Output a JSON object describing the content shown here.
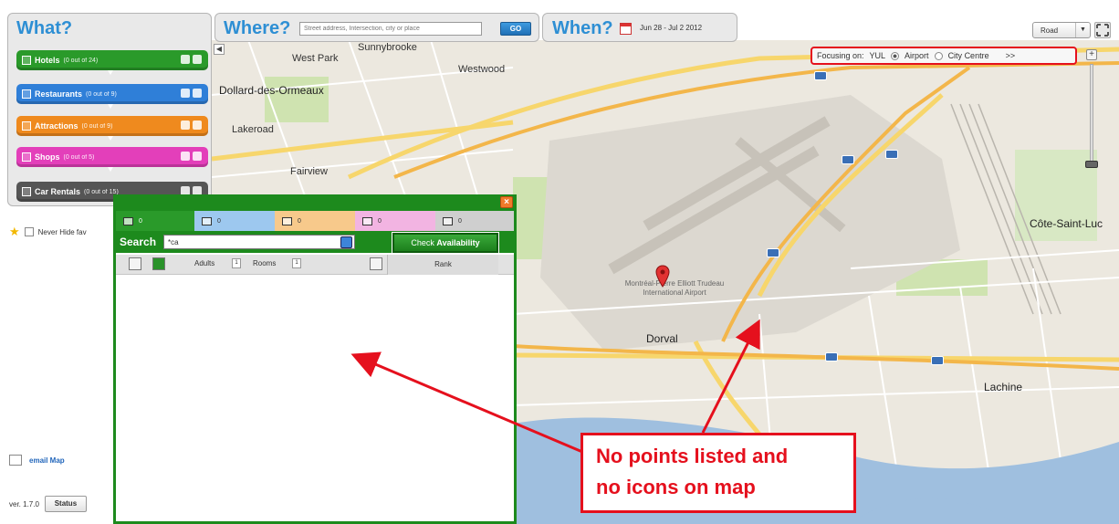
{
  "what": {
    "title": "What?",
    "categories": [
      {
        "label": "Hotels",
        "count": "(0 out of 24)",
        "color": "#2a9a2a"
      },
      {
        "label": "Restaurants",
        "count": "(0 out of 9)",
        "color": "#2f7fd8"
      },
      {
        "label": "Attractions",
        "count": "(0 out of 9)",
        "color": "#ef8a1e"
      },
      {
        "label": "Shops",
        "count": "(0 out of 5)",
        "color": "#e33fba"
      },
      {
        "label": "Car Rentals",
        "count": "(0 out of 15)",
        "color": "#555555"
      }
    ],
    "never_label": "Never Hide fav"
  },
  "where": {
    "title": "Where?",
    "placeholder": "Street address, Intersection, city or place",
    "go_label": "GO"
  },
  "when": {
    "title": "When?",
    "dates": "Jun 28 - Jul 2 2012"
  },
  "map": {
    "type_select": "Road",
    "focus": {
      "label": "Focusing on:",
      "code": "YUL",
      "option1": "Airport",
      "option2": "City Centre",
      "more": ">>"
    },
    "places": {
      "sunnybrooke": "Sunnybrooke",
      "west_park": "West Park",
      "westwood": "Westwood",
      "dollard": "Dollard-des-Ormeaux",
      "lakeroad": "Lakeroad",
      "fairview": "Fairview",
      "dorval": "Dorval",
      "lachine": "Lachine",
      "cote_st_luc": "Côte-Saint-Luc",
      "airport": "Montréal-Pierre Elliott Trudeau International Airport"
    }
  },
  "popup": {
    "tabs": [
      {
        "label": "0",
        "color": "#2a9a2a"
      },
      {
        "label": "0",
        "color": "#9dc8ef"
      },
      {
        "label": "0",
        "color": "#f7c98b"
      },
      {
        "label": "0",
        "color": "#f2b4e2"
      },
      {
        "label": "0",
        "color": "#cfcfcf"
      }
    ],
    "search_label": "Search",
    "search_value": "*ca",
    "check_label_prefix": "Check",
    "check_label_bold": "Availability",
    "adults_label": "Adults",
    "adults_value": "1",
    "rooms_label": "Rooms",
    "rooms_value": "1",
    "rank_label": "Rank"
  },
  "email": {
    "label": "email Map"
  },
  "version": {
    "label": "ver. 1.7.0",
    "status": "Status"
  },
  "annotation": {
    "line1": "No points listed and",
    "line2": "no icons on map"
  }
}
